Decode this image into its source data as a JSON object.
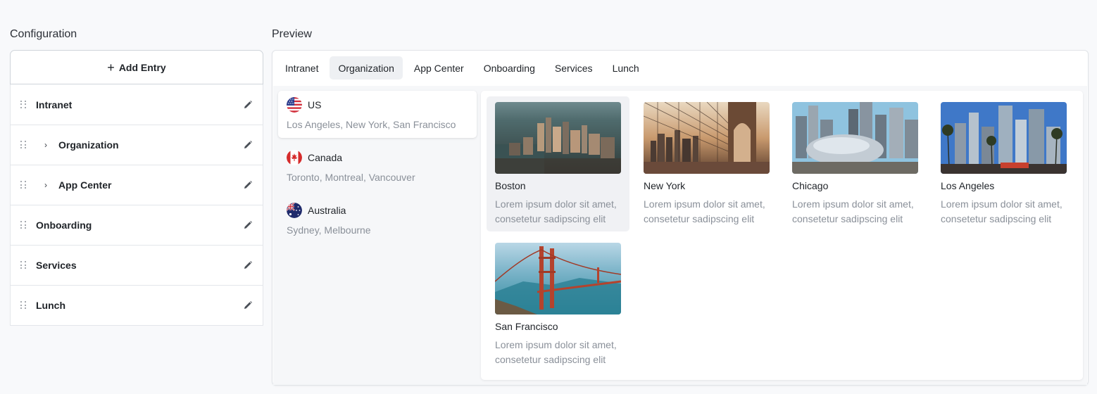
{
  "left": {
    "title": "Configuration",
    "add_entry_label": "Add Entry",
    "entries": [
      {
        "label": "Intranet",
        "expandable": false
      },
      {
        "label": "Organization",
        "expandable": true
      },
      {
        "label": "App Center",
        "expandable": true
      },
      {
        "label": "Onboarding",
        "expandable": false
      },
      {
        "label": "Services",
        "expandable": false
      },
      {
        "label": "Lunch",
        "expandable": false
      }
    ]
  },
  "preview": {
    "title": "Preview",
    "tabs": [
      "Intranet",
      "Organization",
      "App Center",
      "Onboarding",
      "Services",
      "Lunch"
    ],
    "active_tab": "Organization",
    "countries": [
      {
        "name": "US",
        "cities": "Los Angeles, New York, San Francisco",
        "flag": "us-flag-icon"
      },
      {
        "name": "Canada",
        "cities": "Toronto, Montreal, Vancouver",
        "flag": "canada-flag-icon"
      },
      {
        "name": "Australia",
        "cities": "Sydney, Melbourne",
        "flag": "australia-flag-icon"
      }
    ],
    "active_country": "US",
    "cards": [
      {
        "title": "Boston",
        "desc": "Lorem ipsum dolor sit amet, consetetur sadipscing elit",
        "image": "boston-aerial-image"
      },
      {
        "title": "New York",
        "desc": "Lorem ipsum dolor sit amet, consetetur sadipscing elit",
        "image": "brooklyn-bridge-image"
      },
      {
        "title": "Chicago",
        "desc": "Lorem ipsum dolor sit amet, consetetur sadipscing elit",
        "image": "chicago-bean-image"
      },
      {
        "title": "Los Angeles",
        "desc": "Lorem ipsum dolor sit amet, consetetur sadipscing elit",
        "image": "los-angeles-palms-image"
      },
      {
        "title": "San Francisco",
        "desc": "Lorem ipsum dolor sit amet, consetetur sadipscing elit",
        "image": "golden-gate-bridge-image"
      }
    ],
    "active_card": "Boston"
  },
  "colors": {
    "background": "#f8f9fb",
    "active_tab_bg": "#eef0f3",
    "muted_text": "#8a9099",
    "border": "#e3e6ea"
  },
  "icons": {
    "add": "plus-icon",
    "drag": "drag-handle-icon",
    "expand": "chevron-right-icon",
    "edit": "pencil-icon"
  }
}
